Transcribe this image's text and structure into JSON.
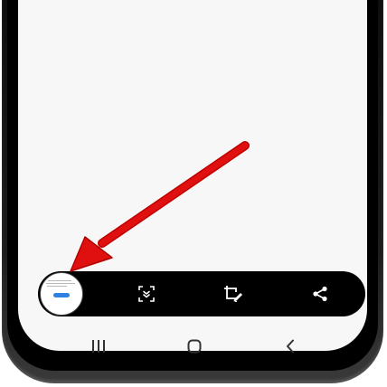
{
  "toolbar": {
    "screenshot_thumbnail": "screenshot-thumbnail",
    "buttons": [
      {
        "name": "scroll-capture",
        "icon": "scroll-capture-icon"
      },
      {
        "name": "crop-edit",
        "icon": "crop-edit-icon"
      },
      {
        "name": "share",
        "icon": "share-icon"
      }
    ]
  },
  "nav": {
    "recents_icon": "recents-icon",
    "home_icon": "home-icon",
    "back_icon": "back-icon"
  },
  "colors": {
    "toolbar": "#000000",
    "screen": "#f7f7f7",
    "accent": "#2f80e0",
    "arrow": "#e01010"
  }
}
